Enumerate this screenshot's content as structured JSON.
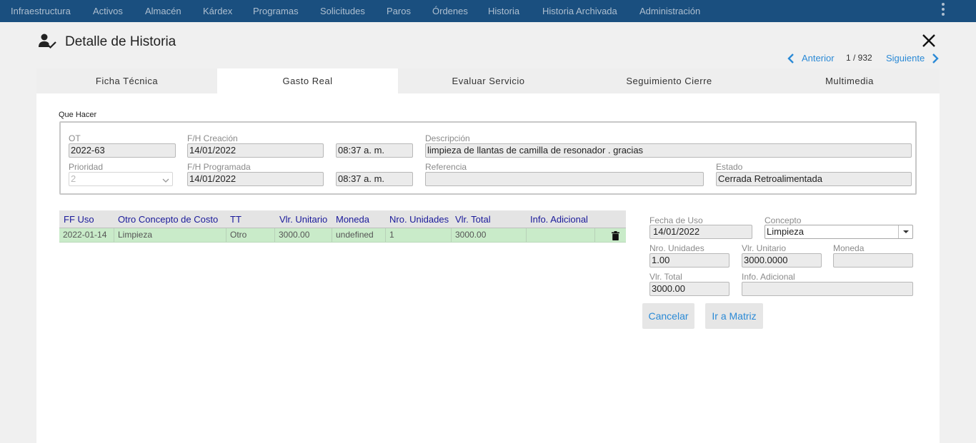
{
  "nav": {
    "items": [
      "Infraestructura",
      "Activos",
      "Almacén",
      "Kárdex",
      "Programas",
      "Solicitudes",
      "Paros",
      "Órdenes",
      "Historia",
      "Historia Archivada",
      "Administración"
    ]
  },
  "header": {
    "title": "Detalle de Historia",
    "prev_label": "Anterior",
    "count": "1 / 932",
    "next_label": "Siguiente"
  },
  "tabs": [
    "Ficha Técnica",
    "Gasto Real",
    "Evaluar Servicio",
    "Seguimiento Cierre",
    "Multimedia"
  ],
  "active_tab": "Gasto Real",
  "que_hacer": {
    "section_label": "Que Hacer",
    "ot_label": "OT",
    "ot_value": "2022-63",
    "creacion_label": "F/H Creación",
    "creacion_date": "14/01/2022",
    "creacion_time": "08:37 a. m.",
    "descripcion_label": "Descripción",
    "descripcion_value": "limpieza de llantas de camilla de resonador . gracias",
    "prioridad_label": "Prioridad",
    "prioridad_value": "2",
    "programada_label": "F/H Programada",
    "programada_date": "14/01/2022",
    "programada_time": "08:37 a. m.",
    "referencia_label": "Referencia",
    "referencia_value": "",
    "estado_label": "Estado",
    "estado_value": "Cerrada Retroalimentada"
  },
  "table": {
    "headers": [
      "FF Uso",
      "Otro Concepto de Costo",
      "TT",
      "Vlr. Unitario",
      "Moneda",
      "Nro. Unidades",
      "Vlr. Total",
      "Info. Adicional"
    ],
    "rows": [
      [
        "2022-01-14",
        "Limpieza",
        "Otro",
        "3000.00",
        "undefined",
        "1",
        "3000.00",
        ""
      ]
    ]
  },
  "form": {
    "fecha_uso_label": "Fecha de Uso",
    "fecha_uso_value": "14/01/2022",
    "concepto_label": "Concepto",
    "concepto_value": "Limpieza",
    "nro_unidades_label": "Nro. Unidades",
    "nro_unidades_value": "1.00",
    "vlr_unitario_label": "Vlr. Unitario",
    "vlr_unitario_value": "3000.0000",
    "moneda_label": "Moneda",
    "moneda_value": "",
    "vlr_total_label": "Vlr. Total",
    "vlr_total_value": "3000.00",
    "info_label": "Info. Adicional",
    "info_value": "",
    "cancel_label": "Cancelar",
    "matrix_label": "Ir a Matriz"
  },
  "colors": {
    "nav_bg": "#1a4f7f",
    "link": "#2b8ad6",
    "row_highlight": "#c9ebc9",
    "header_text": "#1a1a9a"
  }
}
